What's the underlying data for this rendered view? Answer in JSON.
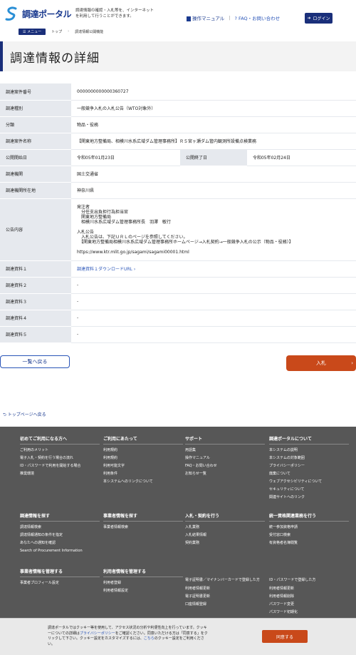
{
  "header": {
    "logo_text": "調達ポータル",
    "tagline": "調達情報の確認・入札等を、インターネットを利用して行うことができます。",
    "manual": "操作マニュアル",
    "faq": "FAQ・お問い合わせ",
    "login": "ログイン"
  },
  "breadcrumb": {
    "menu": "メニュー",
    "top": "トップ",
    "current": "調達情報公開機能"
  },
  "page_title": "調達情報の詳細",
  "details": {
    "case_no_label": "調達案件番号",
    "case_no": "0000000000000360727",
    "type_label": "調達種別",
    "type": "一般競争入札の入札公告（WTO対象外）",
    "category_label": "分類",
    "category": "物品・役務",
    "name_label": "調達案件名称",
    "name": "【関東地方整備局、相模川水系広域ダム管理事務所】Ｒ５宮ヶ瀬ダム管内観測所設備点検業務",
    "start_label": "公開開始日",
    "start": "令和05年01月23日",
    "end_label": "公開終了日",
    "end": "令和05年02月24日",
    "org_label": "調達機関",
    "org": "国土交通省",
    "loc_label": "調達機関所在地",
    "loc": "神奈川県",
    "notice_label": "公告内容",
    "notice": "発注者\n　分任支出負担行為担当官\n　関東地方整備局\n　相模川水系広域ダム管理事務所長　羽澤　敏行\n\n入札公告\n　入札公告は、下記ＵＲＬのページを参照してください。\n　【関東地方整備局相模川水系広域ダム管理事務所ホームページ→入札契約→一般競争入札の公示（物品・役務）】\n\nhttps://www.ktr.mlit.go.jp/sagami/sagami00001.html",
    "doc1_label": "調達資料１",
    "doc1": "調達資料１ダウンロードURL",
    "doc2_label": "調達資料２",
    "doc2": "-",
    "doc3_label": "調達資料３",
    "doc3": "-",
    "doc4_label": "調達資料４",
    "doc4": "-",
    "doc5_label": "調達資料５",
    "doc5": "-"
  },
  "buttons": {
    "back": "一覧へ戻る",
    "bid": "入札"
  },
  "totop": "トップページへ戻る",
  "footer": {
    "c1": {
      "title": "初めてご利用になる方へ",
      "items": [
        "ご利用のメリット",
        "電子入札・契約を行う場合の流れ",
        "ID・パスワードで利用を開始する場合",
        "推奨環境"
      ]
    },
    "c2": {
      "title": "ご利用にあたって",
      "items": [
        "利用規約",
        "利用規約",
        "利用可能文字",
        "利用条件",
        "本システムへのリンクについて"
      ]
    },
    "c3": {
      "title": "サポート",
      "items": [
        "用語集",
        "操作マニュアル",
        "FAQ・お問い合わせ",
        "お知らせ一覧"
      ]
    },
    "c4": {
      "title": "調達ポータルについて",
      "items": [
        "本システムの説明",
        "本システムの対象範囲",
        "プライバシーポリシー",
        "廃棄について",
        "ウェブアクセシビリティについて",
        "セキュリティについて",
        "関連サイトへのリンク"
      ]
    },
    "c5": {
      "title": "調達情報を探す",
      "items": [
        "調達情報検索",
        "調達情報通知の条件を指定",
        "あなたへの通知を確認",
        "Search of Procurement Information"
      ]
    },
    "c6": {
      "title": "事業者情報を探す",
      "items": [
        "事業者情報検索"
      ]
    },
    "c7": {
      "title": "入札・契約を行う",
      "items": [
        "入札業務",
        "入札結果情報",
        "契約業務"
      ]
    },
    "c8": {
      "title": "統一資格関連業務を行う",
      "items": [
        "統一参加資格申請",
        "受付窓口検索",
        "有資格者名簿閲覧"
      ]
    },
    "c9": {
      "title": "事業者情報を管理する",
      "items": [
        "事業者プロフィール設定"
      ]
    },
    "c10": {
      "title": "利用者情報を管理する",
      "items": [
        "利用者登録",
        "利用者情報設定"
      ]
    },
    "c11": {
      "title": "電子証明書／マイナンバーカードで登録した方",
      "items": [
        "利用者情報更新",
        "電子証明書更新",
        "口座情報登録"
      ]
    },
    "c12": {
      "title": "ID・パスワードで登録した方",
      "items": [
        "利用者情報更新",
        "利用者情報削除",
        "パスワード変更",
        "パスワード初期化"
      ]
    }
  },
  "cookie": {
    "text_a": "調達ポータルではクッキー等を使用して、アクセス状況の分析や利便性向上を行っています。クッキーについての詳細は",
    "link_privacy": "プライバシーポリシー",
    "text_b": "をご確認ください。同意いただける方は「同意する」をクリックして下さい。クッキー設定をカスタマイズするには、",
    "link_here": "こちら",
    "text_c": "のクッキー設定をご利用ください。",
    "agree": "同意する"
  },
  "colors": {
    "brand": "#1a2f7a",
    "accent": "#c9491a",
    "label_bg": "#e6e9ee"
  }
}
